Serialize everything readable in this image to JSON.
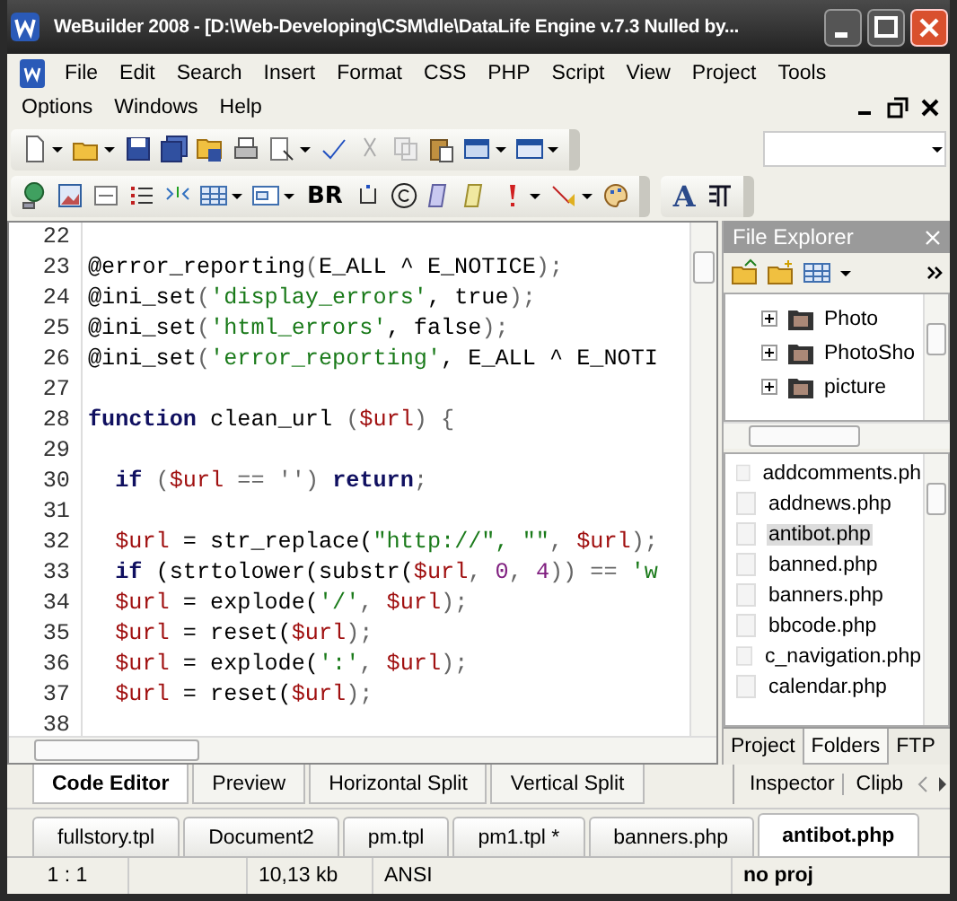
{
  "window": {
    "title": "WeBuilder 2008 - [D:\\Web-Developing\\CSM\\dle\\DataLife Engine v.7.3 Nulled by..."
  },
  "menu": [
    {
      "label": "File"
    },
    {
      "label": "Edit"
    },
    {
      "label": "Search"
    },
    {
      "label": "Insert"
    },
    {
      "label": "Format"
    },
    {
      "label": "CSS"
    },
    {
      "label": "PHP"
    },
    {
      "label": "Script"
    },
    {
      "label": "View"
    },
    {
      "label": "Project"
    },
    {
      "label": "Tools"
    },
    {
      "label": "Options"
    },
    {
      "label": "Windows"
    },
    {
      "label": "Help"
    }
  ],
  "toolbar": {
    "br_label": "BR",
    "font_label": "A"
  },
  "editor": {
    "lines": [
      {
        "number": "22"
      },
      {
        "number": "23",
        "tokens": [
          {
            "t": "@error_reporting",
            "kind": "plain"
          },
          {
            "t": "(",
            "kind": "punct"
          },
          {
            "t": "E_ALL ^ E_NOTICE",
            "kind": "plain"
          },
          {
            "t": ");",
            "kind": "punct"
          }
        ]
      },
      {
        "number": "24",
        "tokens": [
          {
            "t": "@ini_set",
            "kind": "plain"
          },
          {
            "t": "(",
            "kind": "punct"
          },
          {
            "t": "'display_errors'",
            "kind": "string"
          },
          {
            "t": ", true",
            "kind": "plain"
          },
          {
            "t": ");",
            "kind": "punct"
          }
        ]
      },
      {
        "number": "25",
        "tokens": [
          {
            "t": "@ini_set",
            "kind": "plain"
          },
          {
            "t": "(",
            "kind": "punct"
          },
          {
            "t": "'html_errors'",
            "kind": "string"
          },
          {
            "t": ", false",
            "kind": "plain"
          },
          {
            "t": ");",
            "kind": "punct"
          }
        ]
      },
      {
        "number": "26",
        "tokens": [
          {
            "t": "@ini_set",
            "kind": "plain"
          },
          {
            "t": "(",
            "kind": "punct"
          },
          {
            "t": "'error_reporting'",
            "kind": "string"
          },
          {
            "t": ", E_ALL ^ E_NOTI",
            "kind": "plain"
          }
        ]
      },
      {
        "number": "27"
      },
      {
        "number": "28",
        "tokens": [
          {
            "t": "function",
            "kind": "keyword"
          },
          {
            "t": " clean_url ",
            "kind": "plain"
          },
          {
            "t": "(",
            "kind": "punct"
          },
          {
            "t": "$url",
            "kind": "var"
          },
          {
            "t": ") {",
            "kind": "punct"
          }
        ]
      },
      {
        "number": "29"
      },
      {
        "number": "30",
        "indented": true,
        "tokens": [
          {
            "t": "if",
            "kind": "keyword"
          },
          {
            "t": " (",
            "kind": "punct"
          },
          {
            "t": "$url",
            "kind": "var"
          },
          {
            "t": " == ''",
            "kind": "punct"
          },
          {
            "t": ") ",
            "kind": "punct"
          },
          {
            "t": "return",
            "kind": "keyword"
          },
          {
            "t": ";",
            "kind": "punct"
          }
        ]
      },
      {
        "number": "31"
      },
      {
        "number": "32",
        "indented": true,
        "tokens": [
          {
            "t": "$url",
            "kind": "var"
          },
          {
            "t": " = str_replace(",
            "kind": "plain"
          },
          {
            "t": "\"http://\", \"\"",
            "kind": "string"
          },
          {
            "t": ", ",
            "kind": "punct"
          },
          {
            "t": "$url",
            "kind": "var"
          },
          {
            "t": ");",
            "kind": "punct"
          }
        ]
      },
      {
        "number": "33",
        "indented": true,
        "tokens": [
          {
            "t": "if",
            "kind": "keyword"
          },
          {
            "t": " (strtolower(substr(",
            "kind": "plain"
          },
          {
            "t": "$url",
            "kind": "var"
          },
          {
            "t": ", ",
            "kind": "punct"
          },
          {
            "t": "0",
            "kind": "number"
          },
          {
            "t": ", ",
            "kind": "punct"
          },
          {
            "t": "4",
            "kind": "number"
          },
          {
            "t": ")) == ",
            "kind": "punct"
          },
          {
            "t": "'w",
            "kind": "string"
          }
        ]
      },
      {
        "number": "34",
        "indented": true,
        "tokens": [
          {
            "t": "$url",
            "kind": "var"
          },
          {
            "t": " = explode(",
            "kind": "plain"
          },
          {
            "t": "'/'",
            "kind": "string"
          },
          {
            "t": ", ",
            "kind": "punct"
          },
          {
            "t": "$url",
            "kind": "var"
          },
          {
            "t": ");",
            "kind": "punct"
          }
        ]
      },
      {
        "number": "35",
        "indented": true,
        "tokens": [
          {
            "t": "$url",
            "kind": "var"
          },
          {
            "t": " = reset(",
            "kind": "plain"
          },
          {
            "t": "$url",
            "kind": "var"
          },
          {
            "t": ");",
            "kind": "punct"
          }
        ]
      },
      {
        "number": "36",
        "indented": true,
        "tokens": [
          {
            "t": "$url",
            "kind": "var"
          },
          {
            "t": " = explode(",
            "kind": "plain"
          },
          {
            "t": "':'",
            "kind": "string"
          },
          {
            "t": ", ",
            "kind": "punct"
          },
          {
            "t": "$url",
            "kind": "var"
          },
          {
            "t": ");",
            "kind": "punct"
          }
        ]
      },
      {
        "number": "37",
        "indented": true,
        "tokens": [
          {
            "t": "$url",
            "kind": "var"
          },
          {
            "t": " = reset(",
            "kind": "plain"
          },
          {
            "t": "$url",
            "kind": "var"
          },
          {
            "t": ");",
            "kind": "punct"
          }
        ]
      },
      {
        "number": "38"
      }
    ]
  },
  "view_tabs": [
    {
      "label": "Code Editor",
      "selected": true
    },
    {
      "label": "Preview",
      "selected": false
    },
    {
      "label": "Horizontal Split",
      "selected": false
    },
    {
      "label": "Vertical Split",
      "selected": false
    }
  ],
  "file_explorer": {
    "title": "File Explorer",
    "tree": [
      {
        "label": "Photo",
        "expanded": false
      },
      {
        "label": "PhotoSho",
        "expanded": false
      },
      {
        "label": "picture",
        "expanded": false
      }
    ],
    "files": [
      {
        "name": "addcomments.ph",
        "selected": false
      },
      {
        "name": "addnews.php",
        "selected": false
      },
      {
        "name": "antibot.php",
        "selected": true
      },
      {
        "name": "banned.php",
        "selected": false
      },
      {
        "name": "banners.php",
        "selected": false
      },
      {
        "name": "bbcode.php",
        "selected": false
      },
      {
        "name": "c_navigation.php",
        "selected": false
      },
      {
        "name": "calendar.php",
        "selected": false
      }
    ],
    "tabs": [
      {
        "label": "Project",
        "selected": false
      },
      {
        "label": "Folders",
        "selected": true
      },
      {
        "label": "FTP",
        "selected": false
      }
    ]
  },
  "panel_tabs": [
    {
      "label": "Inspector",
      "selected": true
    },
    {
      "label": "Clipb",
      "selected": false
    }
  ],
  "document_tabs": [
    {
      "label": "fullstory.tpl",
      "selected": false
    },
    {
      "label": "Document2",
      "selected": false
    },
    {
      "label": "pm.tpl",
      "selected": false
    },
    {
      "label": "pm1.tpl *",
      "selected": false
    },
    {
      "label": "banners.php",
      "selected": false
    },
    {
      "label": "antibot.php",
      "selected": true
    }
  ],
  "status_bar": [
    {
      "text": "1 : 1"
    },
    {
      "text": "10,13 kb"
    },
    {
      "text": "ANSI"
    },
    {
      "text": "no proj"
    }
  ]
}
